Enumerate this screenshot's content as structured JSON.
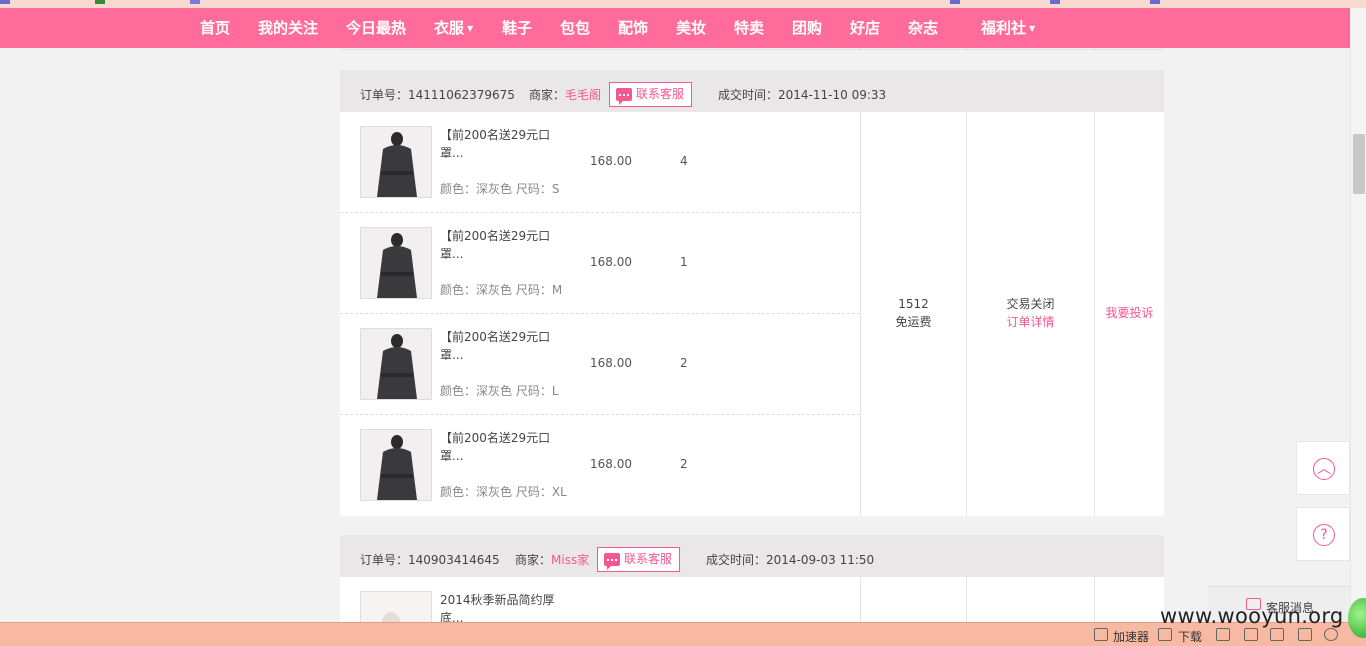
{
  "nav": {
    "items": [
      {
        "label": "首页"
      },
      {
        "label": "我的关注"
      },
      {
        "label": "今日最热"
      },
      {
        "label": "衣服",
        "dropdown": true
      },
      {
        "label": "鞋子"
      },
      {
        "label": "包包"
      },
      {
        "label": "配饰"
      },
      {
        "label": "美妆"
      },
      {
        "label": "特卖"
      },
      {
        "label": "团购"
      },
      {
        "label": "好店"
      },
      {
        "label": "杂志"
      },
      {
        "label": "福利社",
        "dropdown": true
      }
    ]
  },
  "orders": [
    {
      "order_no_label": "订单号：",
      "order_no": "14111062379675",
      "seller_label": "商家：",
      "seller": "毛毛阁",
      "cs_button": "联系客服",
      "time_label": "成交时间：",
      "time": "2014-11-10 09:33",
      "items": [
        {
          "title": "【前200名送29元口罩...",
          "spec": "颜色：深灰色 尺码：S",
          "price": "168.00",
          "qty": "4"
        },
        {
          "title": "【前200名送29元口罩...",
          "spec": "颜色：深灰色 尺码：M",
          "price": "168.00",
          "qty": "1"
        },
        {
          "title": "【前200名送29元口罩...",
          "spec": "颜色：深灰色 尺码：L",
          "price": "168.00",
          "qty": "2"
        },
        {
          "title": "【前200名送29元口罩...",
          "spec": "颜色：深灰色 尺码：XL",
          "price": "168.00",
          "qty": "2"
        }
      ],
      "total": "1512",
      "shipping": "免运费",
      "status": "交易关闭",
      "detail_link": "订单详情",
      "complaint_link": "我要投诉"
    },
    {
      "order_no_label": "订单号：",
      "order_no": "140903414645",
      "seller_label": "商家：",
      "seller": "Miss家",
      "cs_button": "联系客服",
      "time_label": "成交时间：",
      "time": "2014-09-03 11:50",
      "items": [
        {
          "title": "2014秋季新品简约厚底..."
        }
      ]
    }
  ],
  "side": {
    "top_icon": "back-to-top-icon",
    "help_icon": "?"
  },
  "cs_message": {
    "label": "客服消息"
  },
  "statusbar": {
    "accelerator": "加速器",
    "download": "下载"
  },
  "watermark": "www.wooyun.org",
  "colors": {
    "nav": "#ff6c9b",
    "accent": "#f25891",
    "status_bar": "#f8b9a2"
  }
}
